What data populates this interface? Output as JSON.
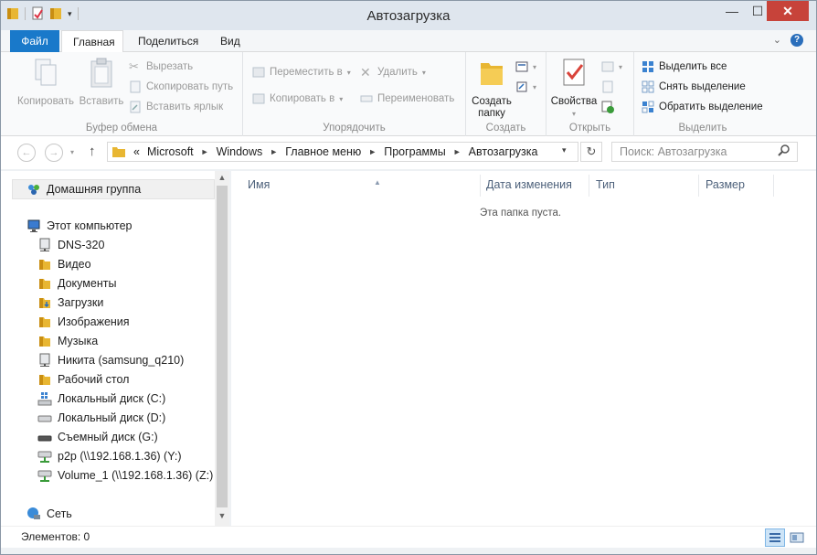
{
  "window": {
    "title": "Автозагрузка"
  },
  "tabs": {
    "file": "Файл",
    "home": "Главная",
    "share": "Поделиться",
    "view": "Вид"
  },
  "ribbon": {
    "clipboard": {
      "label": "Буфер обмена",
      "copy": "Копировать",
      "paste": "Вставить",
      "cut": "Вырезать",
      "copy_path": "Скопировать путь",
      "paste_shortcut": "Вставить ярлык"
    },
    "organize": {
      "label": "Упорядочить",
      "move_to": "Переместить в",
      "copy_to": "Копировать в",
      "delete": "Удалить",
      "rename": "Переименовать"
    },
    "create": {
      "label": "Создать",
      "new_folder_line1": "Создать",
      "new_folder_line2": "папку"
    },
    "open": {
      "label": "Открыть",
      "properties": "Свойства"
    },
    "select": {
      "label": "Выделить",
      "select_all": "Выделить все",
      "select_none": "Снять выделение",
      "invert": "Обратить выделение"
    }
  },
  "address": {
    "prefix": "«",
    "crumbs": [
      "Microsoft",
      "Windows",
      "Главное меню",
      "Программы",
      "Автозагрузка"
    ],
    "search_placeholder": "Поиск: Автозагрузка"
  },
  "nav": {
    "homegroup": "Домашняя группа",
    "computer": "Этот компьютер",
    "items": [
      {
        "label": "DNS-320",
        "icon": "network-drive-icon"
      },
      {
        "label": "Видео",
        "icon": "folder-icon"
      },
      {
        "label": "Документы",
        "icon": "folder-icon"
      },
      {
        "label": "Загрузки",
        "icon": "folder-icon"
      },
      {
        "label": "Изображения",
        "icon": "folder-icon"
      },
      {
        "label": "Музыка",
        "icon": "folder-icon"
      },
      {
        "label": "Никита (samsung_q210)",
        "icon": "network-drive-icon"
      },
      {
        "label": "Рабочий стол",
        "icon": "folder-icon"
      },
      {
        "label": "Локальный диск (C:)",
        "icon": "system-drive-icon"
      },
      {
        "label": "Локальный диск (D:)",
        "icon": "drive-icon"
      },
      {
        "label": "Съемный диск (G:)",
        "icon": "removable-drive-icon"
      },
      {
        "label": "p2p (\\\\192.168.1.36) (Y:)",
        "icon": "mapped-drive-icon"
      },
      {
        "label": "Volume_1 (\\\\192.168.1.36) (Z:)",
        "icon": "mapped-drive-icon"
      }
    ],
    "network": "Сеть"
  },
  "content": {
    "columns": {
      "name": "Имя",
      "date": "Дата изменения",
      "type": "Тип",
      "size": "Размер"
    },
    "empty_text": "Эта папка пуста."
  },
  "status": {
    "text": "Элементов: 0"
  },
  "colors": {
    "accent": "#1979ca",
    "close": "#c7433a",
    "folder": "#e8b632"
  }
}
